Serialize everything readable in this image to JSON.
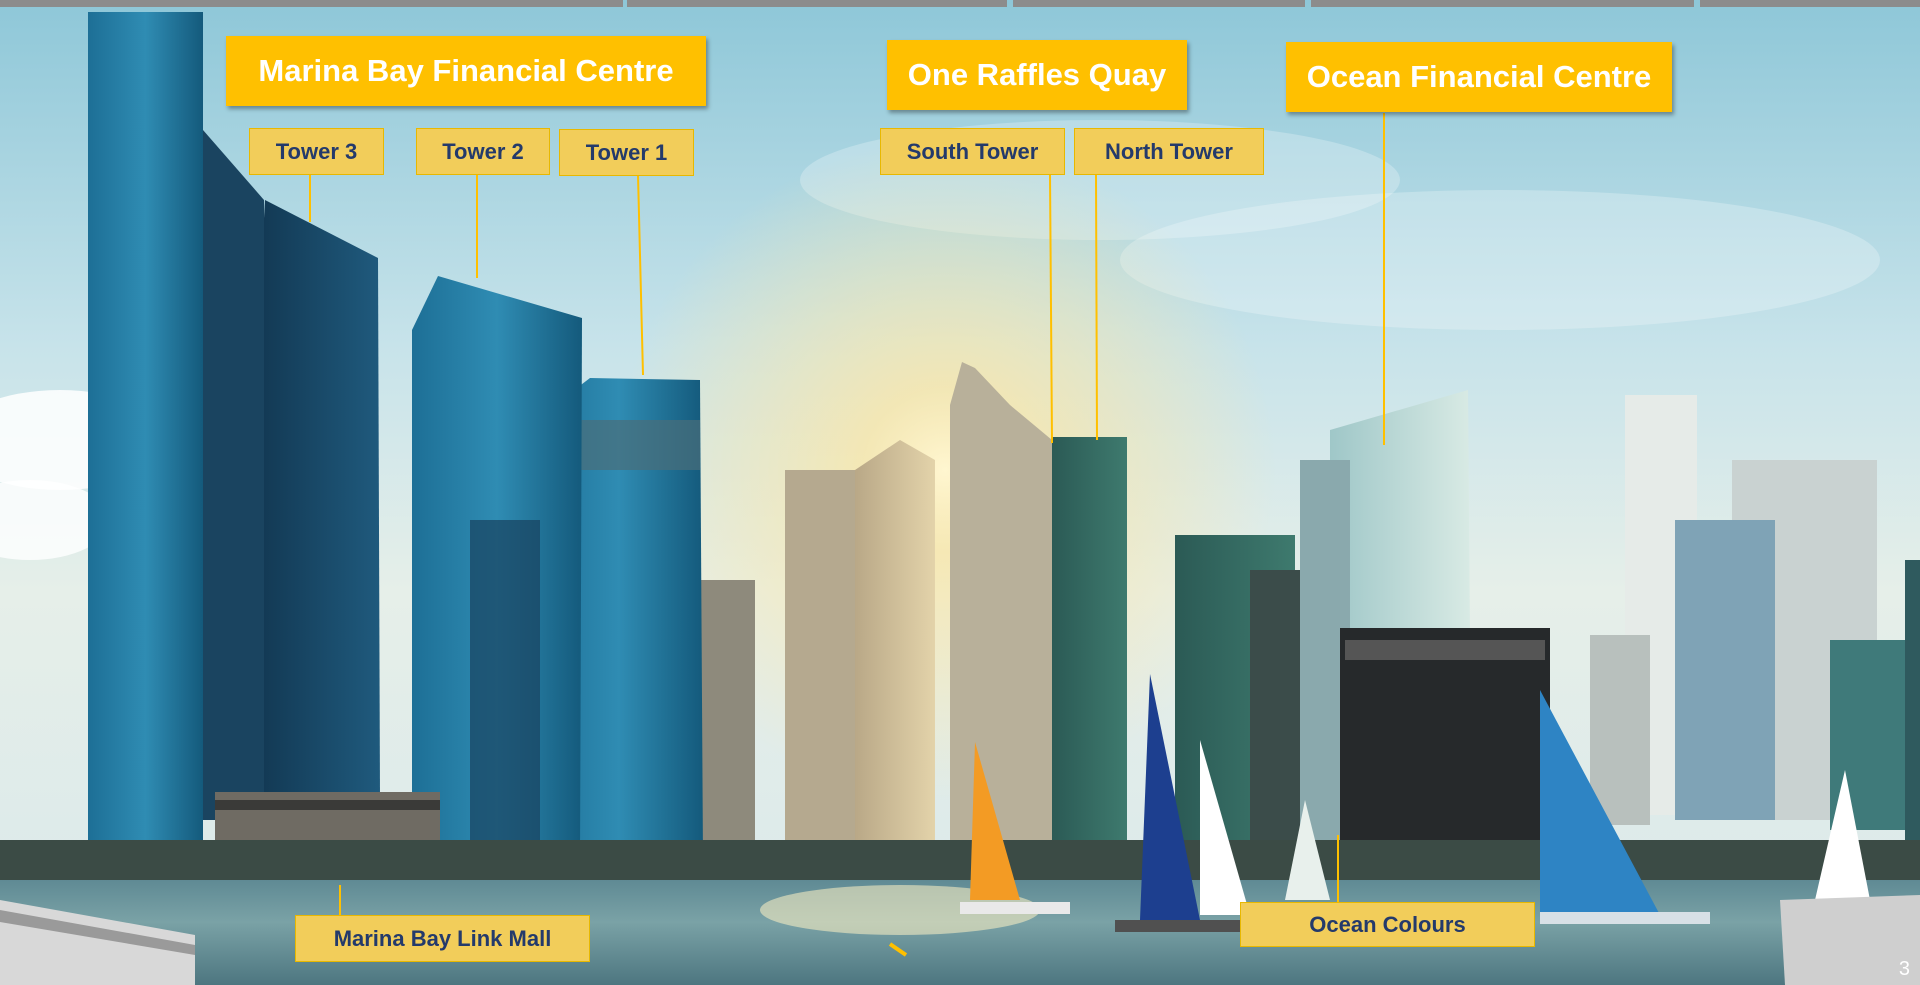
{
  "slide": {
    "page_number": "3"
  },
  "labels": {
    "mbfc": "Marina Bay Financial Centre",
    "tower3": "Tower 3",
    "tower2": "Tower 2",
    "tower1": "Tower 1",
    "orq": "One Raffles Quay",
    "south_tower": "South Tower",
    "north_tower": "North Tower",
    "ofc": "Ocean Financial Centre",
    "link_mall": "Marina Bay Link Mall",
    "ocean_colours": "Ocean Colours"
  },
  "colors": {
    "label_bg": "#ffc000",
    "small_label_bg": "#f2cd5a",
    "small_label_text": "#243a6b",
    "leader_line": "#ffc000"
  }
}
